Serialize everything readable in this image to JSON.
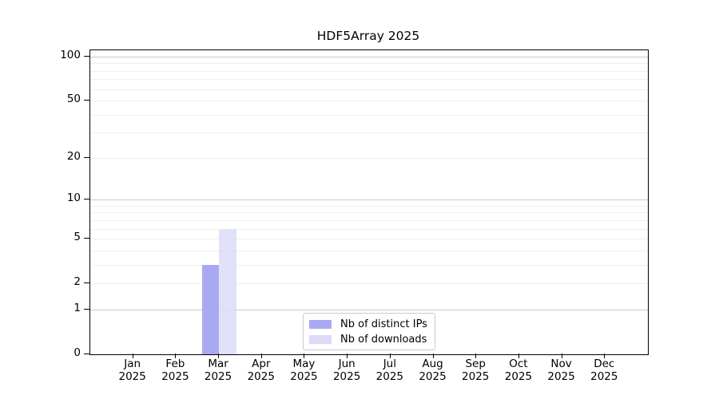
{
  "title": "HDF5Array 2025",
  "colors": {
    "distinct_ips_bar": "#a9a9f3",
    "downloads_bar": "#dcdcf8",
    "grid_minor": "#efefef",
    "grid_major": "#c9c9c9",
    "axis": "#000000",
    "legend_border": "#cccccc"
  },
  "chart_data": {
    "type": "bar",
    "title": "HDF5Array 2025",
    "categories": [
      "Jan",
      "Feb",
      "Mar",
      "Apr",
      "May",
      "Jun",
      "Jul",
      "Aug",
      "Sep",
      "Oct",
      "Nov",
      "Dec"
    ],
    "year_label": "2025",
    "series": [
      {
        "name": "Nb of distinct IPs",
        "color": "#a9a9f3",
        "values": [
          0,
          0,
          3,
          0,
          0,
          0,
          0,
          0,
          0,
          0,
          0,
          0
        ]
      },
      {
        "name": "Nb of downloads",
        "color": "#dcdcf8",
        "values": [
          0,
          0,
          6,
          0,
          0,
          0,
          0,
          0,
          0,
          0,
          0,
          0
        ]
      }
    ],
    "yscale": "log1p",
    "ylim": [
      0,
      100
    ],
    "yticks": [
      0,
      1,
      2,
      5,
      10,
      20,
      50,
      100
    ],
    "grid_minor_values": [
      2,
      3,
      4,
      5,
      6,
      7,
      8,
      9,
      20,
      30,
      40,
      50,
      60,
      70,
      80,
      90
    ],
    "grid_major_values": [
      1,
      10,
      100
    ],
    "grid": "horizontal",
    "legend_position": "bottom-center",
    "xlabel": "",
    "ylabel": ""
  }
}
